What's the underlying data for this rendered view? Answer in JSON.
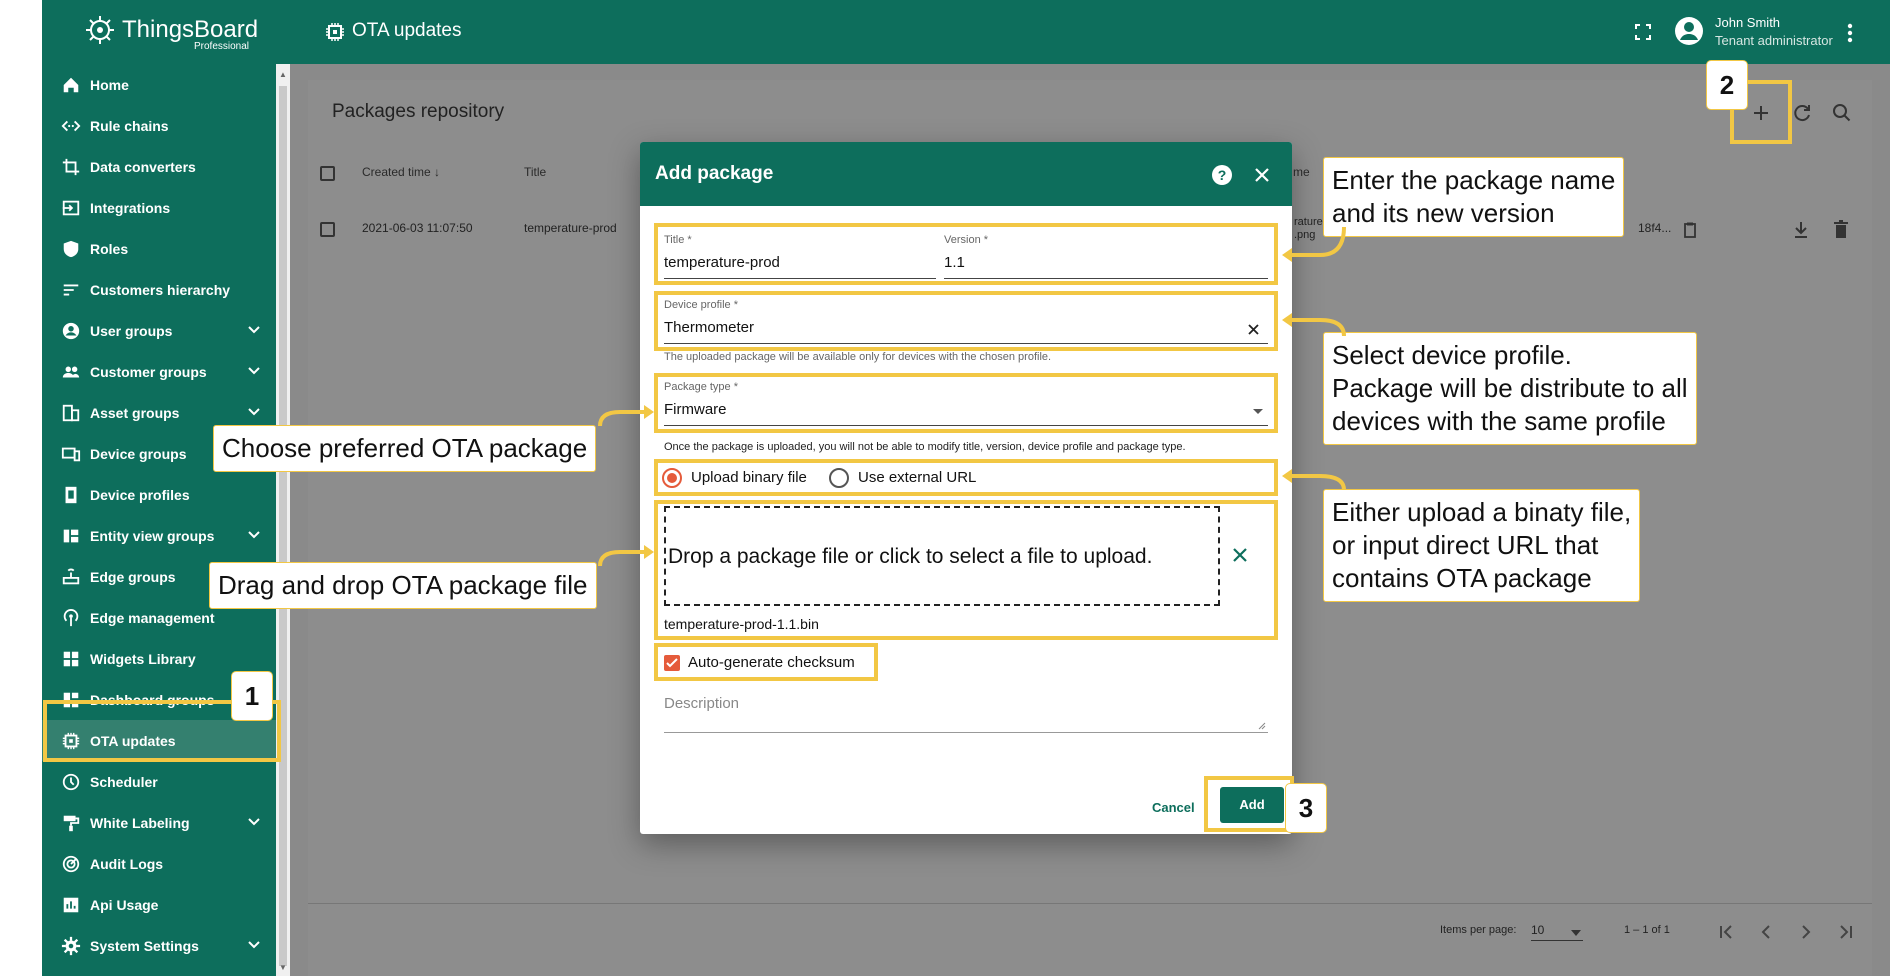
{
  "app": {
    "brand": "ThingsBoard",
    "edition": "Professional",
    "page_title": "OTA updates"
  },
  "user": {
    "name": "John Smith",
    "role": "Tenant administrator"
  },
  "sidebar": {
    "items": [
      {
        "label": "Home",
        "icon": "home-icon"
      },
      {
        "label": "Rule chains",
        "icon": "code-icon"
      },
      {
        "label": "Data converters",
        "icon": "crop-icon"
      },
      {
        "label": "Integrations",
        "icon": "input-icon"
      },
      {
        "label": "Roles",
        "icon": "shield-icon"
      },
      {
        "label": "Customers hierarchy",
        "icon": "sort-icon"
      },
      {
        "label": "User groups",
        "icon": "account-circle-icon",
        "expand": true
      },
      {
        "label": "Customer groups",
        "icon": "people-icon",
        "expand": true
      },
      {
        "label": "Asset groups",
        "icon": "domain-icon",
        "expand": true
      },
      {
        "label": "Device groups",
        "icon": "devices-icon"
      },
      {
        "label": "Device profiles",
        "icon": "device-profile-icon"
      },
      {
        "label": "Entity view groups",
        "icon": "view-quilt-icon",
        "expand": true
      },
      {
        "label": "Edge groups",
        "icon": "router-icon"
      },
      {
        "label": "Edge management",
        "icon": "settings-input-antenna-icon"
      },
      {
        "label": "Widgets Library",
        "icon": "widgets-icon"
      },
      {
        "label": "Dashboard groups",
        "icon": "dashboard-icon"
      },
      {
        "label": "OTA updates",
        "icon": "memory-icon",
        "active": true
      },
      {
        "label": "Scheduler",
        "icon": "schedule-icon"
      },
      {
        "label": "White Labeling",
        "icon": "format-paint-icon",
        "expand": true
      },
      {
        "label": "Audit Logs",
        "icon": "track-changes-icon"
      },
      {
        "label": "Api Usage",
        "icon": "insert-chart-icon"
      },
      {
        "label": "System Settings",
        "icon": "settings-icon",
        "expand": true
      }
    ]
  },
  "repository": {
    "title": "Packages repository",
    "columns": {
      "created_time": "Created time",
      "title": "Title",
      "partial": "me"
    },
    "row": {
      "created_time": "2021-06-03 11:07:50",
      "title": "temperature-prod",
      "partial_file_1": "rature",
      "partial_file_2": ".png",
      "partial_checksum": "18f4..."
    },
    "footer": {
      "items_per_page_label": "Items per page:",
      "items_per_page": "10",
      "range": "1 – 1 of 1"
    }
  },
  "dialog": {
    "title": "Add package",
    "title_label": "Title *",
    "title_value": "temperature-prod",
    "version_label": "Version *",
    "version_value": "1.1",
    "device_profile_label": "Device profile *",
    "device_profile_value": "Thermometer",
    "device_profile_hint": "The uploaded package will be available only for devices with the chosen profile.",
    "package_type_label": "Package type *",
    "package_type_value": "Firmware",
    "package_type_hint": "Once the package is uploaded, you will not be able to modify title, version, device profile and package type.",
    "radio_upload": "Upload binary file",
    "radio_url": "Use external URL",
    "drop_text": "Drop a package file or click to select a file to upload.",
    "file_name": "temperature-prod-1.1.bin",
    "checksum_label": "Auto-generate checksum",
    "description_placeholder": "Description",
    "cancel": "Cancel",
    "add": "Add"
  },
  "annotations": {
    "name_version": "Enter the package name\nand its new version",
    "device_profile": "Select device profile.\nPackage will be distribute to all\ndevices with the same profile",
    "ota_package": "Choose preferred OTA package",
    "upload": "Either upload a binaty file,\nor input direct URL that\ncontains OTA package",
    "drag_drop": "Drag and drop OTA package file",
    "step1": "1",
    "step2": "2",
    "step3": "3"
  },
  "colors": {
    "primary": "#0d6e5c",
    "accent": "#e55b3b",
    "highlight": "#f2c744"
  }
}
